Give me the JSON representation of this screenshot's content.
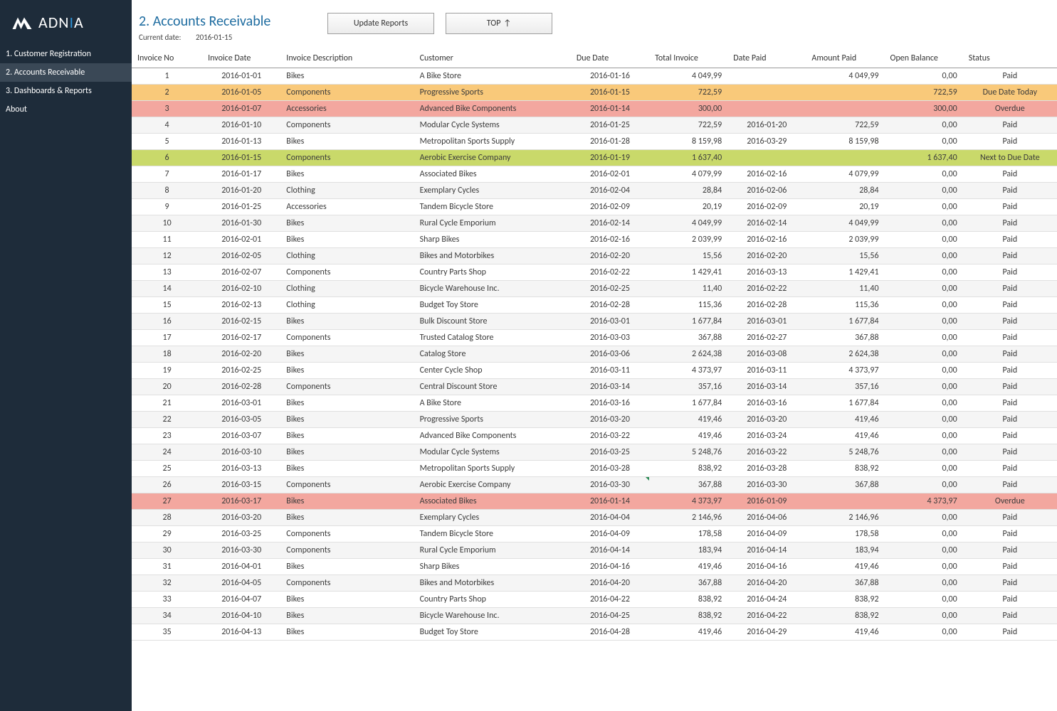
{
  "brand": "ADN",
  "brand_suffix": "A",
  "nav": [
    "1. Customer Registration",
    "2. Accounts Receivable",
    "3. Dashboards & Reports",
    "About"
  ],
  "nav_active": 1,
  "page_title": "2. Accounts Receivable",
  "current_date_label": "Current date:",
  "current_date": "2016-01-15",
  "buttons": {
    "update": "Update Reports",
    "top": "TOP"
  },
  "columns": [
    "Invoice No",
    "Invoice Date",
    "Invoice Description",
    "Customer",
    "Due Date",
    "Total Invoice",
    "Date Paid",
    "Amount Paid",
    "Open Balance",
    "Status"
  ],
  "statuses": {
    "paid": "Paid",
    "due_today": "Due Date Today",
    "overdue": "Overdue",
    "next_due": "Next to Due Date"
  },
  "rows": [
    {
      "no": 1,
      "date": "2016-01-01",
      "desc": "Bikes",
      "cust": "A Bike Store",
      "due": "2016-01-16",
      "total": "4 049,99",
      "paid_date": "",
      "paid": "4 049,99",
      "open": "0,00",
      "status": "paid"
    },
    {
      "no": 2,
      "date": "2016-01-05",
      "desc": "Components",
      "cust": "Progressive Sports",
      "due": "2016-01-15",
      "total": "722,59",
      "paid_date": "",
      "paid": "",
      "open": "722,59",
      "status": "due_today"
    },
    {
      "no": 3,
      "date": "2016-01-07",
      "desc": "Accessories",
      "cust": "Advanced Bike Components",
      "due": "2016-01-14",
      "total": "300,00",
      "paid_date": "",
      "paid": "",
      "open": "300,00",
      "status": "overdue"
    },
    {
      "no": 4,
      "date": "2016-01-10",
      "desc": "Components",
      "cust": "Modular Cycle Systems",
      "due": "2016-01-25",
      "total": "722,59",
      "paid_date": "2016-01-20",
      "paid": "722,59",
      "open": "0,00",
      "status": "paid"
    },
    {
      "no": 5,
      "date": "2016-01-13",
      "desc": "Bikes",
      "cust": "Metropolitan Sports Supply",
      "due": "2016-01-28",
      "total": "8 159,98",
      "paid_date": "2016-03-29",
      "paid": "8 159,98",
      "open": "0,00",
      "status": "paid"
    },
    {
      "no": 6,
      "date": "2016-01-15",
      "desc": "Components",
      "cust": "Aerobic Exercise Company",
      "due": "2016-01-19",
      "total": "1 637,40",
      "paid_date": "",
      "paid": "",
      "open": "1 637,40",
      "status": "next_due"
    },
    {
      "no": 7,
      "date": "2016-01-17",
      "desc": "Bikes",
      "cust": "Associated Bikes",
      "due": "2016-02-01",
      "total": "4 079,99",
      "paid_date": "2016-02-16",
      "paid": "4 079,99",
      "open": "0,00",
      "status": "paid"
    },
    {
      "no": 8,
      "date": "2016-01-20",
      "desc": "Clothing",
      "cust": "Exemplary Cycles",
      "due": "2016-02-04",
      "total": "28,84",
      "paid_date": "2016-02-06",
      "paid": "28,84",
      "open": "0,00",
      "status": "paid"
    },
    {
      "no": 9,
      "date": "2016-01-25",
      "desc": "Accessories",
      "cust": "Tandem Bicycle Store",
      "due": "2016-02-09",
      "total": "20,19",
      "paid_date": "2016-02-09",
      "paid": "20,19",
      "open": "0,00",
      "status": "paid"
    },
    {
      "no": 10,
      "date": "2016-01-30",
      "desc": "Bikes",
      "cust": "Rural Cycle Emporium",
      "due": "2016-02-14",
      "total": "4 049,99",
      "paid_date": "2016-02-14",
      "paid": "4 049,99",
      "open": "0,00",
      "status": "paid"
    },
    {
      "no": 11,
      "date": "2016-02-01",
      "desc": "Bikes",
      "cust": "Sharp Bikes",
      "due": "2016-02-16",
      "total": "2 039,99",
      "paid_date": "2016-02-16",
      "paid": "2 039,99",
      "open": "0,00",
      "status": "paid"
    },
    {
      "no": 12,
      "date": "2016-02-05",
      "desc": "Clothing",
      "cust": "Bikes and Motorbikes",
      "due": "2016-02-20",
      "total": "15,56",
      "paid_date": "2016-02-20",
      "paid": "15,56",
      "open": "0,00",
      "status": "paid"
    },
    {
      "no": 13,
      "date": "2016-02-07",
      "desc": "Components",
      "cust": "Country Parts Shop",
      "due": "2016-02-22",
      "total": "1 429,41",
      "paid_date": "2016-03-13",
      "paid": "1 429,41",
      "open": "0,00",
      "status": "paid"
    },
    {
      "no": 14,
      "date": "2016-02-10",
      "desc": "Clothing",
      "cust": "Bicycle Warehouse Inc.",
      "due": "2016-02-25",
      "total": "11,40",
      "paid_date": "2016-02-22",
      "paid": "11,40",
      "open": "0,00",
      "status": "paid"
    },
    {
      "no": 15,
      "date": "2016-02-13",
      "desc": "Clothing",
      "cust": "Budget Toy Store",
      "due": "2016-02-28",
      "total": "115,36",
      "paid_date": "2016-02-28",
      "paid": "115,36",
      "open": "0,00",
      "status": "paid"
    },
    {
      "no": 16,
      "date": "2016-02-15",
      "desc": "Bikes",
      "cust": "Bulk Discount Store",
      "due": "2016-03-01",
      "total": "1 677,84",
      "paid_date": "2016-03-01",
      "paid": "1 677,84",
      "open": "0,00",
      "status": "paid"
    },
    {
      "no": 17,
      "date": "2016-02-17",
      "desc": "Components",
      "cust": "Trusted Catalog Store",
      "due": "2016-03-03",
      "total": "367,88",
      "paid_date": "2016-02-27",
      "paid": "367,88",
      "open": "0,00",
      "status": "paid"
    },
    {
      "no": 18,
      "date": "2016-02-20",
      "desc": "Bikes",
      "cust": "Catalog Store",
      "due": "2016-03-06",
      "total": "2 624,38",
      "paid_date": "2016-03-08",
      "paid": "2 624,38",
      "open": "0,00",
      "status": "paid"
    },
    {
      "no": 19,
      "date": "2016-02-25",
      "desc": "Bikes",
      "cust": "Center Cycle Shop",
      "due": "2016-03-11",
      "total": "4 373,97",
      "paid_date": "2016-03-11",
      "paid": "4 373,97",
      "open": "0,00",
      "status": "paid"
    },
    {
      "no": 20,
      "date": "2016-02-28",
      "desc": "Components",
      "cust": "Central Discount Store",
      "due": "2016-03-14",
      "total": "357,16",
      "paid_date": "2016-03-14",
      "paid": "357,16",
      "open": "0,00",
      "status": "paid"
    },
    {
      "no": 21,
      "date": "2016-03-01",
      "desc": "Bikes",
      "cust": "A Bike Store",
      "due": "2016-03-16",
      "total": "1 677,84",
      "paid_date": "2016-03-16",
      "paid": "1 677,84",
      "open": "0,00",
      "status": "paid"
    },
    {
      "no": 22,
      "date": "2016-03-05",
      "desc": "Bikes",
      "cust": "Progressive Sports",
      "due": "2016-03-20",
      "total": "419,46",
      "paid_date": "2016-03-20",
      "paid": "419,46",
      "open": "0,00",
      "status": "paid"
    },
    {
      "no": 23,
      "date": "2016-03-07",
      "desc": "Bikes",
      "cust": "Advanced Bike Components",
      "due": "2016-03-22",
      "total": "419,46",
      "paid_date": "2016-03-24",
      "paid": "419,46",
      "open": "0,00",
      "status": "paid"
    },
    {
      "no": 24,
      "date": "2016-03-10",
      "desc": "Bikes",
      "cust": "Modular Cycle Systems",
      "due": "2016-03-25",
      "total": "5 248,76",
      "paid_date": "2016-03-22",
      "paid": "5 248,76",
      "open": "0,00",
      "status": "paid"
    },
    {
      "no": 25,
      "date": "2016-03-13",
      "desc": "Bikes",
      "cust": "Metropolitan Sports Supply",
      "due": "2016-03-28",
      "total": "838,92",
      "paid_date": "2016-03-28",
      "paid": "838,92",
      "open": "0,00",
      "status": "paid"
    },
    {
      "no": 26,
      "date": "2016-03-15",
      "desc": "Components",
      "cust": "Aerobic Exercise Company",
      "due": "2016-03-30",
      "total": "367,88",
      "paid_date": "2016-03-30",
      "paid": "367,88",
      "open": "0,00",
      "status": "paid",
      "marker": true
    },
    {
      "no": 27,
      "date": "2016-03-17",
      "desc": "Bikes",
      "cust": "Associated Bikes",
      "due": "2016-01-14",
      "total": "4 373,97",
      "paid_date": "2016-01-09",
      "paid": "",
      "open": "4 373,97",
      "status": "overdue"
    },
    {
      "no": 28,
      "date": "2016-03-20",
      "desc": "Bikes",
      "cust": "Exemplary Cycles",
      "due": "2016-04-04",
      "total": "2 146,96",
      "paid_date": "2016-04-06",
      "paid": "2 146,96",
      "open": "0,00",
      "status": "paid"
    },
    {
      "no": 29,
      "date": "2016-03-25",
      "desc": "Components",
      "cust": "Tandem Bicycle Store",
      "due": "2016-04-09",
      "total": "178,58",
      "paid_date": "2016-04-09",
      "paid": "178,58",
      "open": "0,00",
      "status": "paid"
    },
    {
      "no": 30,
      "date": "2016-03-30",
      "desc": "Components",
      "cust": "Rural Cycle Emporium",
      "due": "2016-04-14",
      "total": "183,94",
      "paid_date": "2016-04-14",
      "paid": "183,94",
      "open": "0,00",
      "status": "paid"
    },
    {
      "no": 31,
      "date": "2016-04-01",
      "desc": "Bikes",
      "cust": "Sharp Bikes",
      "due": "2016-04-16",
      "total": "419,46",
      "paid_date": "2016-04-16",
      "paid": "419,46",
      "open": "0,00",
      "status": "paid"
    },
    {
      "no": 32,
      "date": "2016-04-05",
      "desc": "Components",
      "cust": "Bikes and Motorbikes",
      "due": "2016-04-20",
      "total": "367,88",
      "paid_date": "2016-04-20",
      "paid": "367,88",
      "open": "0,00",
      "status": "paid"
    },
    {
      "no": 33,
      "date": "2016-04-07",
      "desc": "Bikes",
      "cust": "Country Parts Shop",
      "due": "2016-04-22",
      "total": "838,92",
      "paid_date": "2016-04-24",
      "paid": "838,92",
      "open": "0,00",
      "status": "paid"
    },
    {
      "no": 34,
      "date": "2016-04-10",
      "desc": "Bikes",
      "cust": "Bicycle Warehouse Inc.",
      "due": "2016-04-25",
      "total": "838,92",
      "paid_date": "2016-04-22",
      "paid": "838,92",
      "open": "0,00",
      "status": "paid"
    },
    {
      "no": 35,
      "date": "2016-04-13",
      "desc": "Bikes",
      "cust": "Budget Toy Store",
      "due": "2016-04-28",
      "total": "419,46",
      "paid_date": "2016-04-29",
      "paid": "419,46",
      "open": "0,00",
      "status": "paid"
    }
  ]
}
